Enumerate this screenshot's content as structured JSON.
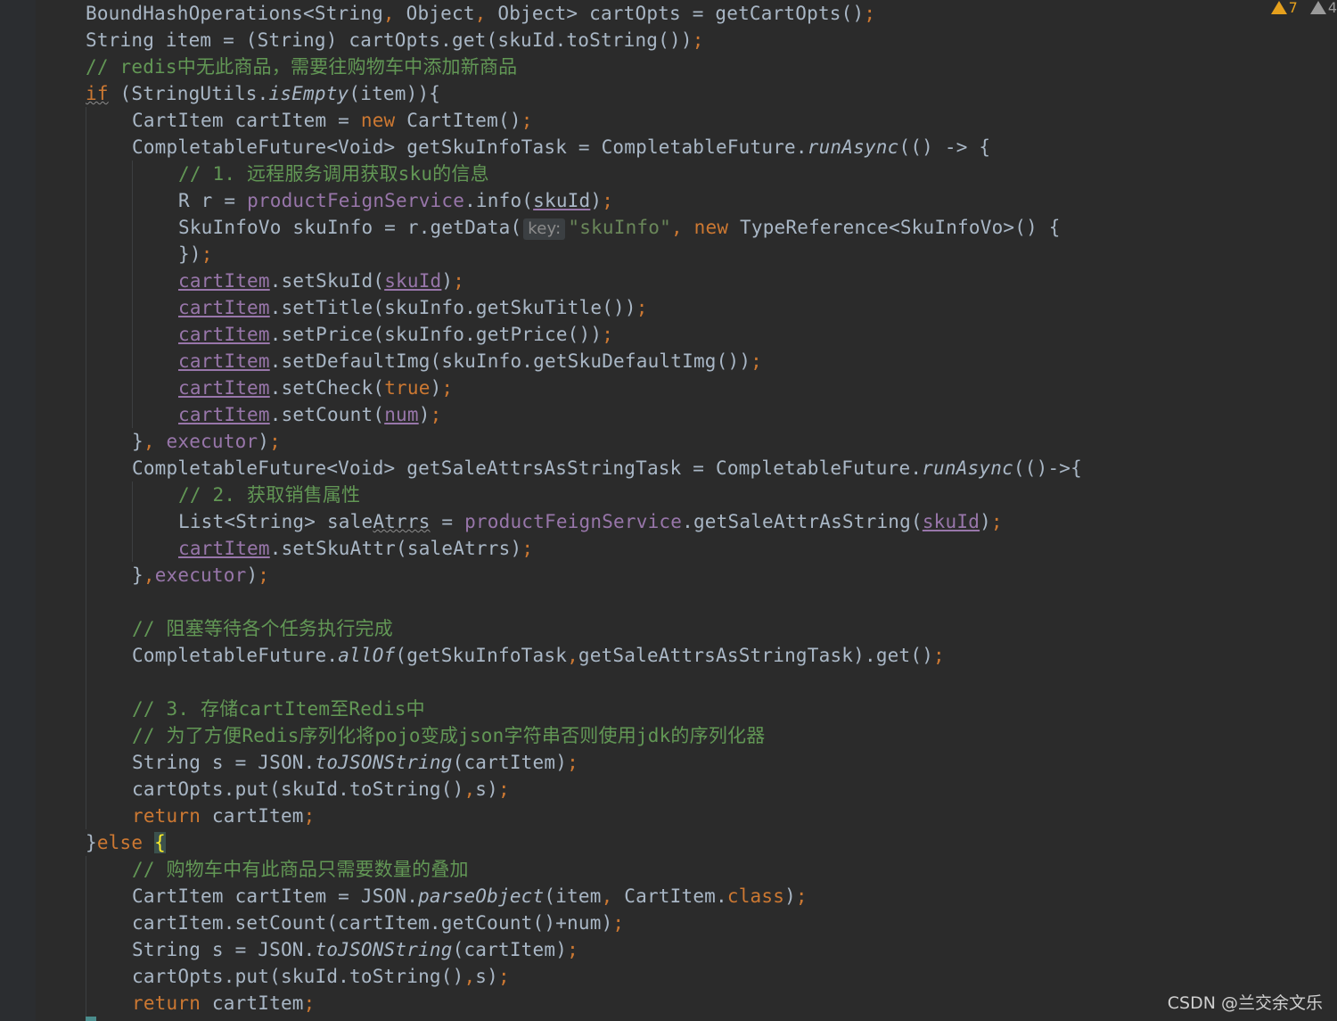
{
  "inspection": {
    "warnings": "7",
    "weak_warnings": "4"
  },
  "watermark": "CSDN @兰交余文乐",
  "code": {
    "l1": {
      "a": "BoundHashOperations<String",
      "b": ", ",
      "c": "Object",
      "d": ", ",
      "e": "Object> cartOpts = getCartOpts()",
      "f": ";"
    },
    "l2": {
      "a": "String item = (String) cartOpts.get(skuId.toString())",
      "b": ";"
    },
    "l3": {
      "a": "// redis中无此商品，需要往购物车中添加新商品"
    },
    "l4": {
      "kw": "if",
      "a": " (StringUtils.",
      "m": "isEmpty",
      "b": "(item)){"
    },
    "l5": {
      "a": "CartItem cartItem = ",
      "kw": "new",
      "b": " CartItem()",
      "c": ";"
    },
    "l6": {
      "a": "CompletableFuture<Void> getSkuInfoTask = CompletableFuture.",
      "m": "runAsync",
      "b": "(() -> {"
    },
    "l7": {
      "a": "// 1. 远程服务调用获取sku的信息"
    },
    "l8": {
      "a": "R r = ",
      "f": "productFeignService",
      "b": ".info(",
      "u": "skuId",
      "c": ")",
      "d": ";"
    },
    "l9": {
      "a": "SkuInfoVo skuInfo = r.getData(",
      "hint": "key:",
      "s": "\"skuInfo\"",
      "b": ", ",
      "kw": "new",
      "c": " TypeReference<SkuInfoVo>() {"
    },
    "l10": {
      "a": "})",
      "b": ";"
    },
    "l11": {
      "u": "cartItem",
      "a": ".setSkuId(",
      "u2": "skuId",
      "b": ")",
      "c": ";"
    },
    "l12": {
      "u": "cartItem",
      "a": ".setTitle(skuInfo.getSkuTitle())",
      "b": ";"
    },
    "l13": {
      "u": "cartItem",
      "a": ".setPrice(skuInfo.getPrice())",
      "b": ";"
    },
    "l14": {
      "u": "cartItem",
      "a": ".setDefaultImg(skuInfo.getSkuDefaultImg())",
      "b": ";"
    },
    "l15": {
      "u": "cartItem",
      "a": ".setCheck(",
      "kw": "true",
      "b": ")",
      "c": ";"
    },
    "l16": {
      "u": "cartItem",
      "a": ".setCount(",
      "u2": "num",
      "b": ")",
      "c": ";"
    },
    "l17": {
      "a": "}",
      "b": ", ",
      "f": "executor",
      "c": ")",
      "d": ";"
    },
    "l18": {
      "a": "CompletableFuture<Void> getSaleAttrsAsStringTask = CompletableFuture.",
      "m": "runAsync",
      "b": "(()->{"
    },
    "l19": {
      "a": "// 2. 获取销售属性"
    },
    "l20": {
      "a": "List<String> sale",
      "w": "Atrrs",
      "b": " = ",
      "f": "productFeignService",
      "c": ".getSaleAttrAsString(",
      "u": "skuId",
      "d": ")",
      "e": ";"
    },
    "l21": {
      "u": "cartItem",
      "a": ".setSkuAttr(saleAtrrs)",
      "b": ";"
    },
    "l22": {
      "a": "}",
      "b": ",",
      "f": "executor",
      "c": ")",
      "d": ";"
    },
    "l24": {
      "a": "// 阻塞等待各个任务执行完成"
    },
    "l25": {
      "a": "CompletableFuture.",
      "m": "allOf",
      "b": "(getSkuInfoTask",
      "c": ",",
      "d": "getSaleAttrsAsStringTask).get()",
      "e": ";"
    },
    "l27": {
      "a": "// 3. 存储cartItem至Redis中"
    },
    "l28": {
      "a": "// 为了方便Redis序列化将pojo变成json字符串否则使用jdk的序列化器"
    },
    "l29": {
      "a": "String s = JSON.",
      "m": "toJSONString",
      "b": "(cartItem)",
      "c": ";"
    },
    "l30": {
      "a": "cartOpts.put(skuId.toString()",
      "b": ",",
      "c": "s)",
      "d": ";"
    },
    "l31": {
      "kw": "return",
      "a": " cartItem",
      "b": ";"
    },
    "l32": {
      "a": "}",
      "kw": "else",
      "b": " ",
      "br": "{"
    },
    "l33": {
      "a": "// 购物车中有此商品只需要数量的叠加"
    },
    "l34": {
      "a": "CartItem cartItem = JSON.",
      "m": "parseObject",
      "b": "(item",
      "c": ", ",
      "d": "CartItem.",
      "kw": "class",
      "e": ")",
      "f": ";"
    },
    "l35": {
      "a": "cartItem.setCount(cartItem.getCount()+num)",
      "b": ";"
    },
    "l36": {
      "a": "String s = JSON.",
      "m": "toJSONString",
      "b": "(cartItem)",
      "c": ";"
    },
    "l37": {
      "a": "cartOpts.put(skuId.toString()",
      "b": ",",
      "c": "s)",
      "d": ";"
    },
    "l38": {
      "kw": "return",
      "a": " cartItem",
      "b": ";"
    }
  }
}
